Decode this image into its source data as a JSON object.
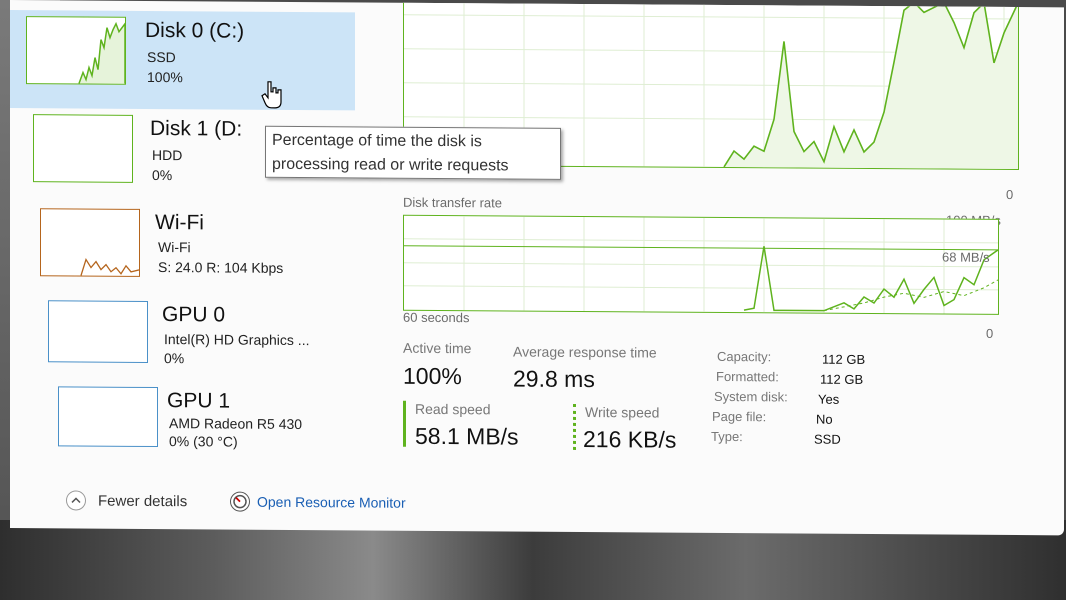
{
  "sidebar": {
    "items": [
      {
        "title": "Disk 0 (C:)",
        "sub1": "SSD",
        "sub2": "100%"
      },
      {
        "title": "Disk 1 (D:",
        "sub1": "HDD",
        "sub2": "0%"
      },
      {
        "title": "Wi-Fi",
        "sub1": "Wi-Fi",
        "sub2": "S: 24.0  R: 104 Kbps"
      },
      {
        "title": "GPU 0",
        "sub1": "Intel(R) HD Graphics ...",
        "sub2": "0%"
      },
      {
        "title": "GPU 1",
        "sub1": "AMD Radeon R5 430",
        "sub2": "0%  (30 °C)"
      }
    ]
  },
  "tooltip": {
    "line1": "Percentage of time the disk is",
    "line2": "processing read or write requests"
  },
  "graphs": {
    "main_bottom_label": "0",
    "rate_title": "Disk transfer rate",
    "rate_max": "100 MB/s",
    "rate_mark": "68 MB/s",
    "rate_bottom": "0",
    "time_label": "60 seconds"
  },
  "stats": {
    "active_time_label": "Active time",
    "active_time_value": "100%",
    "avg_response_label": "Average response time",
    "avg_response_value": "29.8 ms",
    "read_label": "Read speed",
    "read_value": "58.1 MB/s",
    "write_label": "Write speed",
    "write_value": "216 KB/s"
  },
  "properties": [
    {
      "key": "Capacity:",
      "value": "112 GB"
    },
    {
      "key": "Formatted:",
      "value": "112 GB"
    },
    {
      "key": "System disk:",
      "value": "Yes"
    },
    {
      "key": "Page file:",
      "value": "No"
    },
    {
      "key": "Type:",
      "value": "SSD"
    }
  ],
  "footer": {
    "fewer_details": "Fewer details",
    "resource_monitor": "Open Resource Monitor"
  },
  "colors": {
    "accent": "#5fb31e",
    "selected": "#cce4f7",
    "wifi": "#b5651d",
    "gpu": "#4a90c8",
    "link": "#1a5fb4"
  },
  "icons": [
    "chevron-up-icon",
    "resource-monitor-icon",
    "hand-cursor-icon"
  ]
}
